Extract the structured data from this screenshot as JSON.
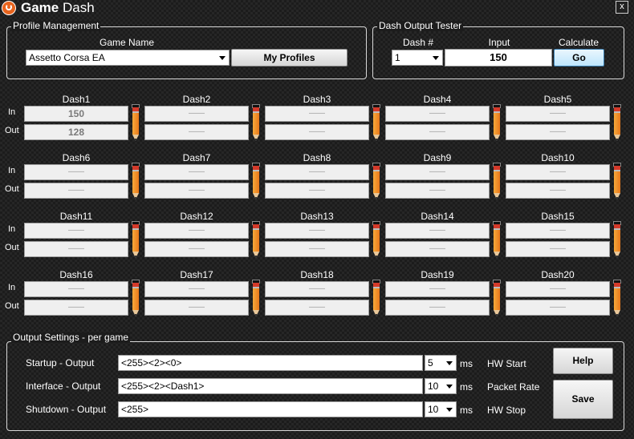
{
  "window": {
    "title_bold": "Game",
    "title_rest": " Dash",
    "close_label": "x"
  },
  "profile": {
    "legend": "Profile Management",
    "game_name_label": "Game Name",
    "game_selected": "Assetto Corsa EA",
    "my_profiles_button": "My Profiles"
  },
  "tester": {
    "legend": "Dash Output Tester",
    "dash_label": "Dash #",
    "input_label": "Input",
    "calculate_label": "Calculate",
    "dash_selected": "1",
    "input_value": "150",
    "go_button": "Go"
  },
  "dash_grid": {
    "in_label": "In",
    "out_label": "Out",
    "rows": [
      [
        {
          "name": "Dash1",
          "in": "150",
          "out": "128"
        },
        {
          "name": "Dash2",
          "in": "——",
          "out": "——"
        },
        {
          "name": "Dash3",
          "in": "——",
          "out": "——"
        },
        {
          "name": "Dash4",
          "in": "——",
          "out": "——"
        },
        {
          "name": "Dash5",
          "in": "——",
          "out": "——"
        }
      ],
      [
        {
          "name": "Dash6",
          "in": "——",
          "out": "——"
        },
        {
          "name": "Dash7",
          "in": "——",
          "out": "——"
        },
        {
          "name": "Dash8",
          "in": "——",
          "out": "——"
        },
        {
          "name": "Dash9",
          "in": "——",
          "out": "——"
        },
        {
          "name": "Dash10",
          "in": "——",
          "out": "——"
        }
      ],
      [
        {
          "name": "Dash11",
          "in": "——",
          "out": "——"
        },
        {
          "name": "Dash12",
          "in": "——",
          "out": "——"
        },
        {
          "name": "Dash13",
          "in": "——",
          "out": "——"
        },
        {
          "name": "Dash14",
          "in": "——",
          "out": "——"
        },
        {
          "name": "Dash15",
          "in": "——",
          "out": "——"
        }
      ],
      [
        {
          "name": "Dash16",
          "in": "——",
          "out": "——"
        },
        {
          "name": "Dash17",
          "in": "——",
          "out": "——"
        },
        {
          "name": "Dash18",
          "in": "——",
          "out": "——"
        },
        {
          "name": "Dash19",
          "in": "——",
          "out": "——"
        },
        {
          "name": "Dash20",
          "in": "——",
          "out": "——"
        }
      ]
    ]
  },
  "output": {
    "legend": "Output Settings - per game",
    "rows": [
      {
        "label": "Startup - Output",
        "value": "<255><2><0>",
        "ms": "5",
        "ms_unit": "ms",
        "hw_label": "HW Start"
      },
      {
        "label": "Interface - Output",
        "value": "<255><2><Dash1>",
        "ms": "10",
        "ms_unit": "ms",
        "hw_label": "Packet Rate"
      },
      {
        "label": "Shutdown - Output",
        "value": "<255>",
        "ms": "10",
        "ms_unit": "ms",
        "hw_label": "HW Stop"
      }
    ],
    "help_button": "Help",
    "save_button": "Save"
  },
  "colors": {
    "accent_blue": "#bee6fd",
    "pencil_orange": "#e8781c",
    "eraser_red": "#d43a2a"
  }
}
